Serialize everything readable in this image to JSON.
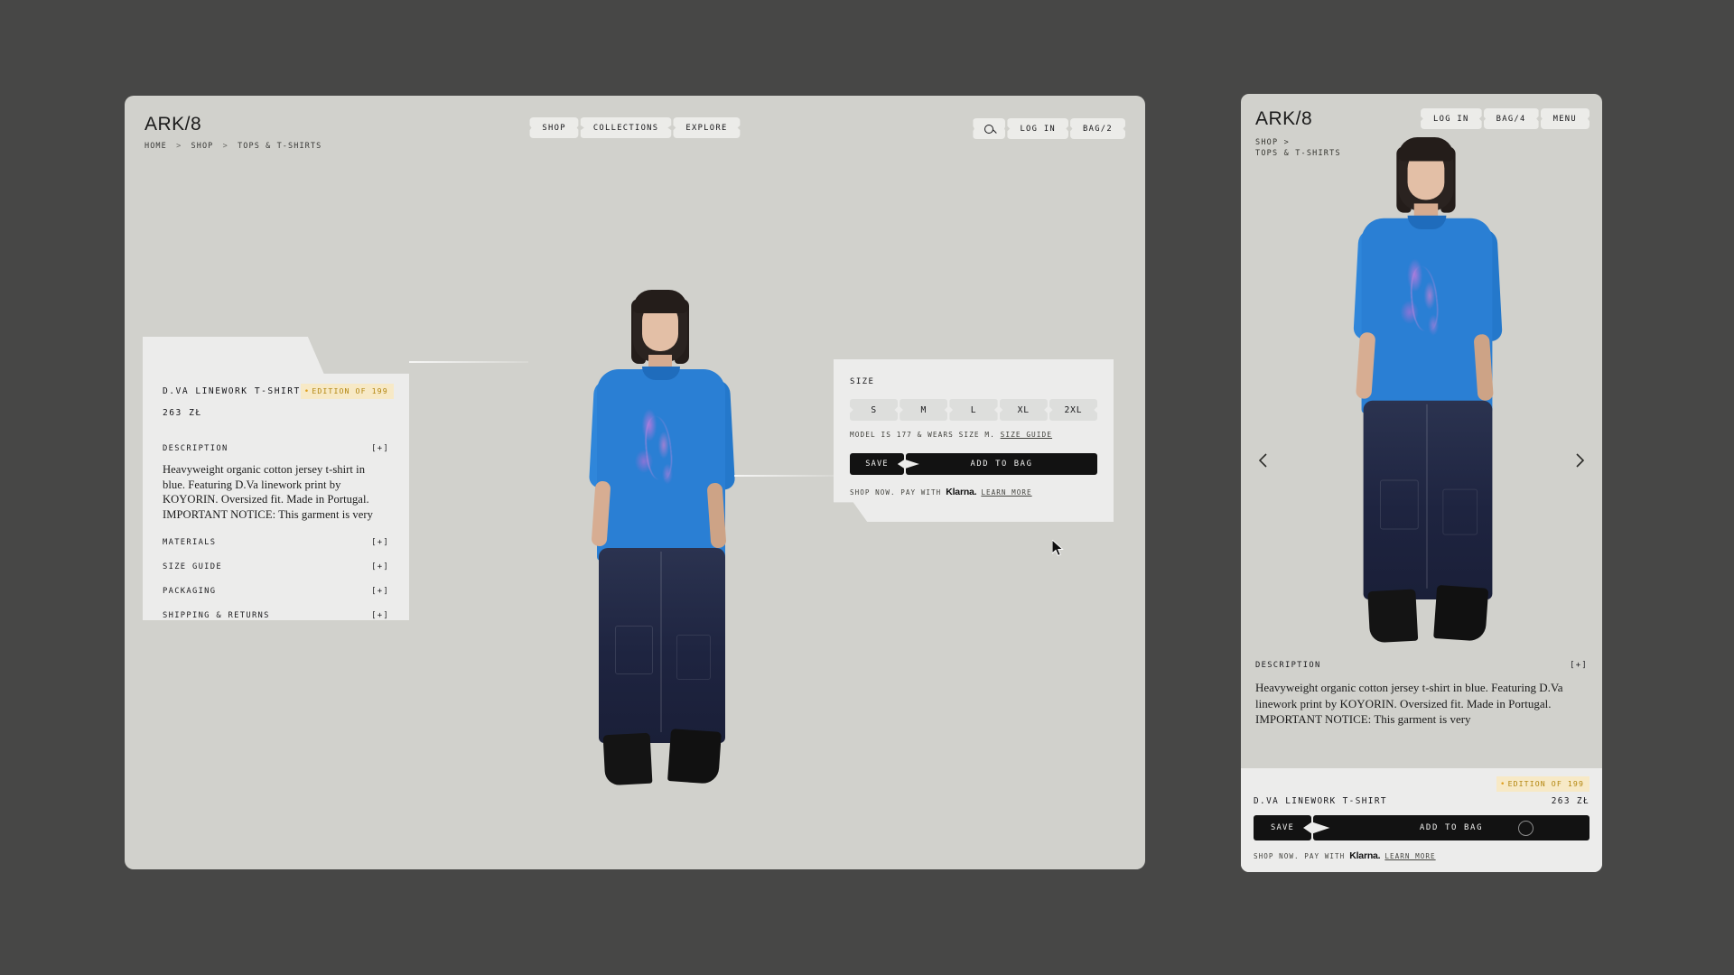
{
  "brand": "ARK/8",
  "desktop": {
    "breadcrumb": {
      "items": [
        "HOME",
        "SHOP",
        "TOPS & T-SHIRTS"
      ],
      "separator": ">"
    },
    "nav": [
      {
        "label": "SHOP",
        "name": "nav-shop"
      },
      {
        "label": "COLLECTIONS",
        "name": "nav-collections"
      },
      {
        "label": "EXPLORE",
        "name": "nav-explore"
      }
    ],
    "actions": [
      {
        "label": "",
        "icon": "search-icon",
        "name": "search-button"
      },
      {
        "label": "LOG IN",
        "name": "log-in-button"
      },
      {
        "label": "BAG/2",
        "name": "bag-button"
      }
    ],
    "product": {
      "title": "D.VA LINEWORK T-SHIRT",
      "price": "263 ZŁ",
      "edition_badge": "EDITION OF 199",
      "edition_dot": "•"
    },
    "accordions": [
      {
        "label": "DESCRIPTION",
        "toggle": "[+]",
        "expanded": true,
        "body": "Heavyweight organic cotton jersey t-shirt in blue. Featuring D.Va linework print by KOYORIN. Oversized fit. Made in Portugal. IMPORTANT NOTICE: This garment is very"
      },
      {
        "label": "MATERIALS",
        "toggle": "[+]",
        "expanded": false
      },
      {
        "label": "SIZE GUIDE",
        "toggle": "[+]",
        "expanded": false
      },
      {
        "label": "PACKAGING",
        "toggle": "[+]",
        "expanded": false
      },
      {
        "label": "SHIPPING & RETURNS",
        "toggle": "[+]",
        "expanded": false
      }
    ],
    "size_panel": {
      "label": "SIZE",
      "options": [
        "S",
        "M",
        "L",
        "XL",
        "2XL"
      ],
      "hovered": "M",
      "note": "MODEL IS 177 & WEARS SIZE M.",
      "note_link": "SIZE GUIDE",
      "save_label": "SAVE",
      "bag_label": "ADD TO BAG",
      "klarna_prefix": "SHOP NOW. PAY WITH",
      "klarna_mark": "Klarna.",
      "klarna_link": "LEARN MORE"
    }
  },
  "mobile": {
    "breadcrumb_line1": "SHOP >",
    "breadcrumb_line2": "TOPS & T-SHIRTS",
    "actions": [
      {
        "label": "LOG IN",
        "name": "log-in-button"
      },
      {
        "label": "BAG/4",
        "name": "bag-button"
      },
      {
        "label": "MENU",
        "name": "menu-button"
      }
    ],
    "carousel": {
      "prev": "‹",
      "next": "›"
    },
    "description": {
      "label": "DESCRIPTION",
      "toggle": "[+]",
      "body": "Heavyweight organic cotton jersey t-shirt in blue. Featuring D.Va linework print by KOYORIN. Oversized fit. Made in Portugal. IMPORTANT NOTICE: This garment is very"
    },
    "product": {
      "edition_badge": "EDITION OF 199",
      "edition_dot": "•",
      "title": "D.VA LINEWORK T-SHIRT",
      "price": "263 ZŁ"
    },
    "cta": {
      "save_label": "SAVE",
      "bag_label": "ADD TO BAG",
      "klarna_prefix": "SHOP NOW. PAY WITH",
      "klarna_mark": "Klarna.",
      "klarna_link": "LEARN MORE"
    }
  },
  "colors": {
    "page_background": "#474746",
    "frame_background": "#d1d1cc",
    "panel_background": "#ececeb",
    "accent_dark": "#121212",
    "edition_gold_text": "#b3860f",
    "edition_gold_bg": "#f7e9c6",
    "shirt_blue": "#2a7fd4"
  }
}
